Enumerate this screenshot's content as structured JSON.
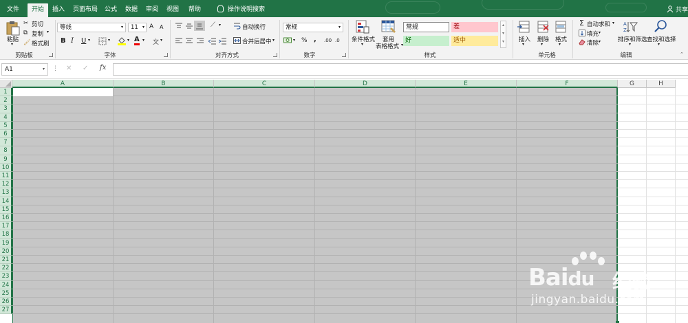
{
  "tabs": [
    "文件",
    "开始",
    "插入",
    "页面布局",
    "公式",
    "数据",
    "审阅",
    "视图",
    "帮助"
  ],
  "active_tab": "开始",
  "tell_me": "操作说明搜索",
  "share": "共享",
  "clipboard": {
    "paste": "粘贴",
    "cut": "剪切",
    "copy": "复制",
    "format_painter": "格式刷",
    "label": "剪贴板"
  },
  "font": {
    "name": "等线",
    "size": "11",
    "grow": "A",
    "shrink": "A",
    "bold": "B",
    "italic": "I",
    "underline": "U",
    "font_color_letter": "A",
    "change_case": "文",
    "label": "字体"
  },
  "alignment": {
    "wrap": "自动换行",
    "merge": "合并后居中",
    "label": "对齐方式"
  },
  "number": {
    "format": "常规",
    "percent": "%",
    "comma": ",",
    "inc_dec": ".00",
    "dec_dec": ".0",
    "label": "数字"
  },
  "styles": {
    "conditional": "条件格式",
    "table_line1": "套用",
    "table_line2": "表格格式",
    "normal": "常规",
    "bad": "差",
    "good": "好",
    "neutral": "适中",
    "label": "样式"
  },
  "cells": {
    "insert": "插入",
    "delete": "删除",
    "format": "格式",
    "label": "单元格"
  },
  "editing": {
    "autosum": "自动求和",
    "fill": "填充",
    "clear": "清除",
    "sort": "排序和筛选",
    "find": "查找和选择",
    "label": "编辑"
  },
  "formula_bar": {
    "name_box": "A1",
    "fx": "fx",
    "value": ""
  },
  "columns": [
    "A",
    "B",
    "C",
    "D",
    "E",
    "F",
    "G",
    "H"
  ],
  "selected_columns": [
    "A",
    "B",
    "C",
    "D",
    "E",
    "F"
  ],
  "rows": [
    "1",
    "2",
    "3",
    "4",
    "5",
    "6",
    "7",
    "8",
    "9",
    "10",
    "11",
    "12",
    "13",
    "14",
    "15",
    "16",
    "17",
    "18",
    "19",
    "20",
    "21",
    "22",
    "23",
    "24",
    "25",
    "26",
    "27"
  ],
  "watermark": {
    "brand": "Bai",
    "brand2": "du",
    "cn": "经验",
    "url": "jingyan.baidu.com"
  },
  "colors": {
    "accent": "#217346",
    "selection": "#c6c6c6",
    "style_bad_bg": "#ffc7ce",
    "style_bad_fg": "#9c0006",
    "style_good_bg": "#c6efce",
    "style_good_fg": "#006100",
    "style_neutral_bg": "#ffeb9c",
    "style_neutral_fg": "#9c5700"
  }
}
